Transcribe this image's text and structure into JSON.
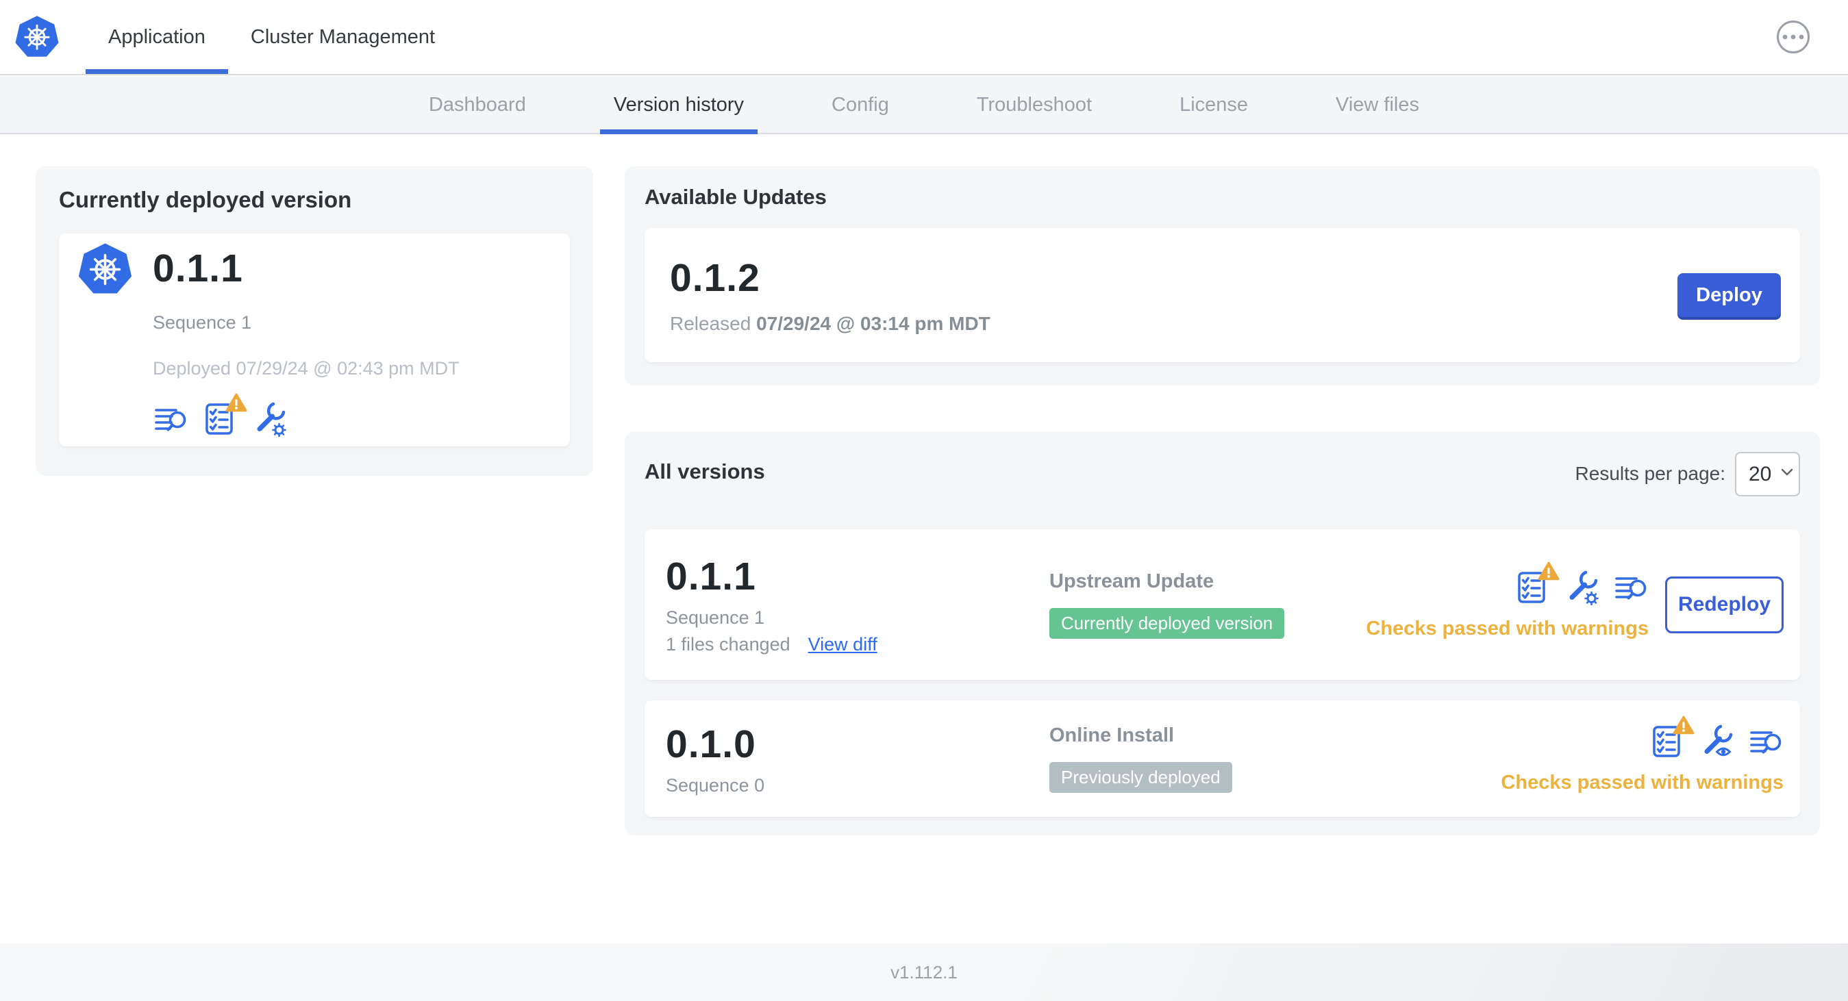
{
  "header": {
    "tabs": [
      {
        "label": "Application",
        "active": true
      },
      {
        "label": "Cluster Management",
        "active": false
      }
    ],
    "menu_icon": "ellipsis-menu-icon",
    "logo_icon": "kubernetes-logo"
  },
  "subnav": {
    "tabs": [
      {
        "label": "Dashboard",
        "active": false
      },
      {
        "label": "Version history",
        "active": true
      },
      {
        "label": "Config",
        "active": false
      },
      {
        "label": "Troubleshoot",
        "active": false
      },
      {
        "label": "License",
        "active": false
      },
      {
        "label": "View files",
        "active": false
      }
    ]
  },
  "current_version": {
    "title": "Currently deployed version",
    "version": "0.1.1",
    "sequence": "Sequence 1",
    "deployed": "Deployed 07/29/24 @ 02:43 pm MDT",
    "icons": [
      "view-logs-icon",
      "preflight-checks-warning-icon",
      "edit-config-icon"
    ]
  },
  "available_updates": {
    "title": "Available Updates",
    "version": "0.1.2",
    "released_prefix": "Released",
    "released_date": "07/29/24 @ 03:14 pm MDT",
    "deploy_label": "Deploy"
  },
  "all_versions": {
    "title": "All versions",
    "results_per_page_label": "Results per page:",
    "results_per_page_value": "20",
    "rows": [
      {
        "version": "0.1.1",
        "sequence": "Sequence 1",
        "files_changed": "1 files changed",
        "view_diff_label": "View diff",
        "source": "Upstream Update",
        "badge": "Currently deployed version",
        "badge_color": "#65c492",
        "icons": [
          "preflight-checks-warning-icon",
          "edit-config-icon",
          "view-logs-icon"
        ],
        "status": "Checks passed with warnings",
        "action_label": "Redeploy"
      },
      {
        "version": "0.1.0",
        "sequence": "Sequence 0",
        "source": "Online Install",
        "badge": "Previously deployed",
        "badge_color": "#b3bfc3",
        "icons": [
          "preflight-checks-warning-icon",
          "view-config-icon",
          "view-logs-icon"
        ],
        "status": "Checks passed with warnings"
      }
    ]
  },
  "footer": {
    "version": "v1.112.1"
  },
  "colors": {
    "accent_blue": "#3a5ed8",
    "link_blue": "#2f6bf0",
    "icon_blue": "#326de6",
    "tab_underline": "#3d6ddb",
    "badge_green": "#65c492",
    "badge_gray": "#b3bfc3",
    "warning_amber": "#ecb23e",
    "card_gray": "#f5f6f8",
    "kubernetes_blue": "#326ce5"
  }
}
